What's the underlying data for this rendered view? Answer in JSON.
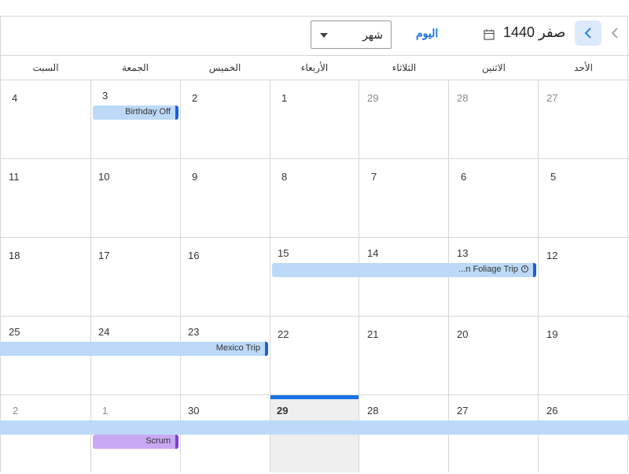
{
  "header": {
    "month_title": "صفر 1440",
    "today_label": "اليوم",
    "view_select": {
      "selected": "شهر"
    }
  },
  "weekdays": [
    "الأحد",
    "الاثنين",
    "الثلاثاء",
    "الأربعاء",
    "الخميس",
    "الجمعة",
    "السبت"
  ],
  "weeks": [
    [
      "27",
      "28",
      "29",
      "1",
      "2",
      "3",
      "4"
    ],
    [
      "5",
      "6",
      "7",
      "8",
      "9",
      "10",
      "11"
    ],
    [
      "12",
      "13",
      "14",
      "15",
      "16",
      "17",
      "18"
    ],
    [
      "19",
      "20",
      "21",
      "22",
      "23",
      "24",
      "25"
    ],
    [
      "26",
      "27",
      "28",
      "29",
      "30",
      "1",
      "2"
    ]
  ],
  "today": "29",
  "events": {
    "birthday": "Birthday Off",
    "foliage": "...n Foliage Trip",
    "mexico": "Mexico Trip",
    "scrum": "Scrum"
  },
  "colors": {
    "accent": "#1a73e8",
    "event_blue": "#bcdaf8",
    "event_purple": "#c9a8f3"
  }
}
